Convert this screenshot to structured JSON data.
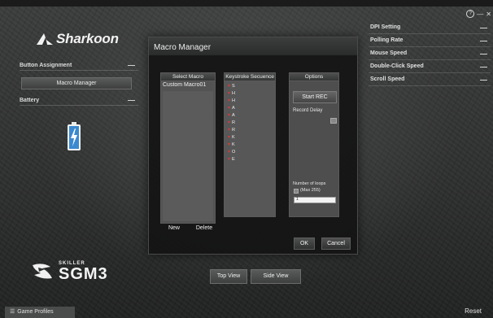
{
  "brand": {
    "name": "Sharkoon"
  },
  "window_controls": {
    "help": "?",
    "minimize": "—",
    "close": "✕"
  },
  "left_panel": {
    "button_assignment": "Button Assignment",
    "macro_manager_button": "Macro Manager",
    "battery": "Battery",
    "collapse": "—"
  },
  "right_panel": {
    "items": [
      {
        "label": "DPI Setting",
        "toggle": "—"
      },
      {
        "label": "Polling Rate",
        "toggle": "—"
      },
      {
        "label": "Mouse Speed",
        "toggle": "—"
      },
      {
        "label": "Double-Click Speed",
        "toggle": "—"
      },
      {
        "label": "Scroll Speed",
        "toggle": "—"
      }
    ]
  },
  "dialog": {
    "title": "Macro Manager",
    "select_macro_header": "Select Macro",
    "keystroke_header": "Keystroke Secuence",
    "options_header": "Options",
    "macros": [
      "Custom Macro01"
    ],
    "keystrokes": [
      "S",
      "H",
      "H",
      "A",
      "A",
      "R",
      "R",
      "K",
      "K",
      "O",
      "E"
    ],
    "start_rec": "Start REC",
    "record_delay": "Record Delay",
    "number_of_loops": "Number of loops",
    "max_loops": "(Max 255)",
    "loops_value": "1",
    "new": "New",
    "delete": "Delete",
    "ok": "OK",
    "cancel": "Cancel"
  },
  "bottom": {
    "product_small": "SKILLER",
    "product_big": "SGM3",
    "top_view": "Top View",
    "side_view": "Side View",
    "game_profiles": "Game Profiles",
    "reset": "Reset"
  }
}
